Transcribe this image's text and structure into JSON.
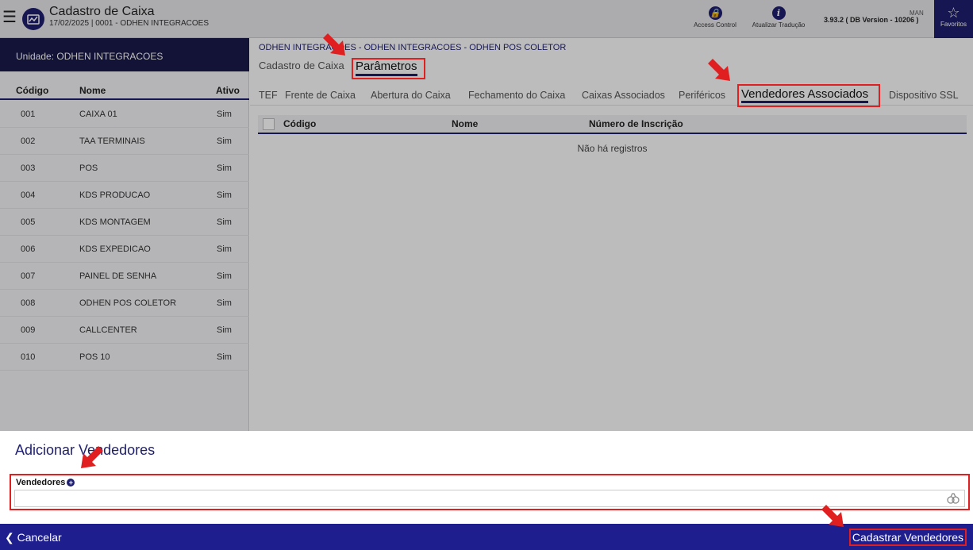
{
  "header": {
    "title": "Cadastro de Caixa",
    "subtitle": "17/02/2025 | 0001 - ODHEN INTEGRACOES",
    "access_control": "Access Control",
    "update_translation": "Atualizar Tradução",
    "version": "3.93.2 ( DB Version - 10206 )",
    "user_short": "MAN",
    "favorites": "Favoritos"
  },
  "left_panel": {
    "unit_label": "Unidade: ODHEN INTEGRACOES",
    "columns": [
      "Código",
      "Nome",
      "Ativo"
    ],
    "rows": [
      {
        "codigo": "001",
        "nome": "CAIXA 01",
        "ativo": "Sim"
      },
      {
        "codigo": "002",
        "nome": "TAA TERMINAIS",
        "ativo": "Sim"
      },
      {
        "codigo": "003",
        "nome": "POS",
        "ativo": "Sim"
      },
      {
        "codigo": "004",
        "nome": "KDS PRODUCAO",
        "ativo": "Sim"
      },
      {
        "codigo": "005",
        "nome": "KDS MONTAGEM",
        "ativo": "Sim"
      },
      {
        "codigo": "006",
        "nome": "KDS EXPEDICAO",
        "ativo": "Sim"
      },
      {
        "codigo": "007",
        "nome": "PAINEL DE SENHA",
        "ativo": "Sim"
      },
      {
        "codigo": "008",
        "nome": "ODHEN POS COLETOR",
        "ativo": "Sim"
      },
      {
        "codigo": "009",
        "nome": "CALLCENTER",
        "ativo": "Sim"
      },
      {
        "codigo": "010",
        "nome": "POS 10",
        "ativo": "Sim"
      }
    ]
  },
  "main": {
    "breadcrumb": "ODHEN INTEGRACOES - ODHEN INTEGRACOES - ODHEN POS COLETOR",
    "tabs": [
      "Cadastro de Caixa",
      "Parâmetros"
    ],
    "subtabs": [
      "TEF",
      "Frente de Caixa",
      "Abertura do Caixa",
      "Fechamento do Caixa",
      "Caixas Associados",
      "Periféricos",
      "Vendedores Associados",
      "Dispositivo SSL"
    ],
    "grid_columns": [
      "Código",
      "Nome",
      "Número de Inscrição"
    ],
    "empty_text": "Não há registros"
  },
  "sheet": {
    "title": "Adicionar Vendedores",
    "field_label": "Vendedores",
    "field_value": "",
    "cancel_label": "Cancelar",
    "save_label": "Cadastrar Vendedores"
  },
  "colors": {
    "brand": "#1e1e6e",
    "footer": "#1e1e8e",
    "annotation": "#e02020"
  }
}
